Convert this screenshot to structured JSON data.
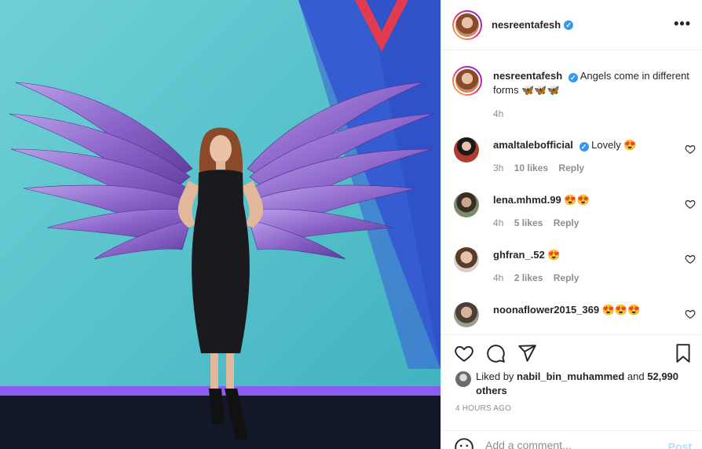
{
  "post": {
    "author": "nesreentafesh",
    "more_icon": "more-horizontal-icon",
    "image_alt": "Woman in black dress posing in front of purple angel wings mural"
  },
  "caption": {
    "username": "nesreentafesh",
    "text": "Angels come in different forms 🦋🦋🦋",
    "time": "4h"
  },
  "comments": [
    {
      "username": "amaltalebofficial",
      "verified": true,
      "text": "Lovely 😍",
      "time": "3h",
      "likes": "10 likes",
      "reply": "Reply",
      "avatar_color": "#b23b2f"
    },
    {
      "username": "lena.mhmd.99",
      "verified": false,
      "text": "😍😍",
      "time": "4h",
      "likes": "5 likes",
      "reply": "Reply",
      "avatar_color": "#6a5a4a"
    },
    {
      "username": "ghfran_.52",
      "verified": false,
      "text": "😍",
      "time": "4h",
      "likes": "2 likes",
      "reply": "Reply",
      "avatar_color": "#c8a48c"
    },
    {
      "username": "noonaflower2015_369",
      "verified": false,
      "text": "😍😍😍",
      "time": "",
      "likes": "",
      "reply": "",
      "avatar_color": "#8a8a7a"
    }
  ],
  "actions": {
    "like_icon": "heart-icon",
    "comment_icon": "comment-icon",
    "share_icon": "share-icon",
    "save_icon": "bookmark-icon"
  },
  "likes": {
    "prefix": "Liked by",
    "user": "nabil_bin_muhammed",
    "middle": "and",
    "count": "52,990 others"
  },
  "age": "4 HOURS AGO",
  "add_comment": {
    "placeholder": "Add a comment...",
    "post_label": "Post",
    "emoji_icon": "smiley-icon"
  },
  "colors": {
    "verified": "#3897f0",
    "muted": "#8e8e8e",
    "post_disabled": "#b2dffc",
    "mural_bg": "#52bfc7",
    "wing": "#8b63c9"
  }
}
